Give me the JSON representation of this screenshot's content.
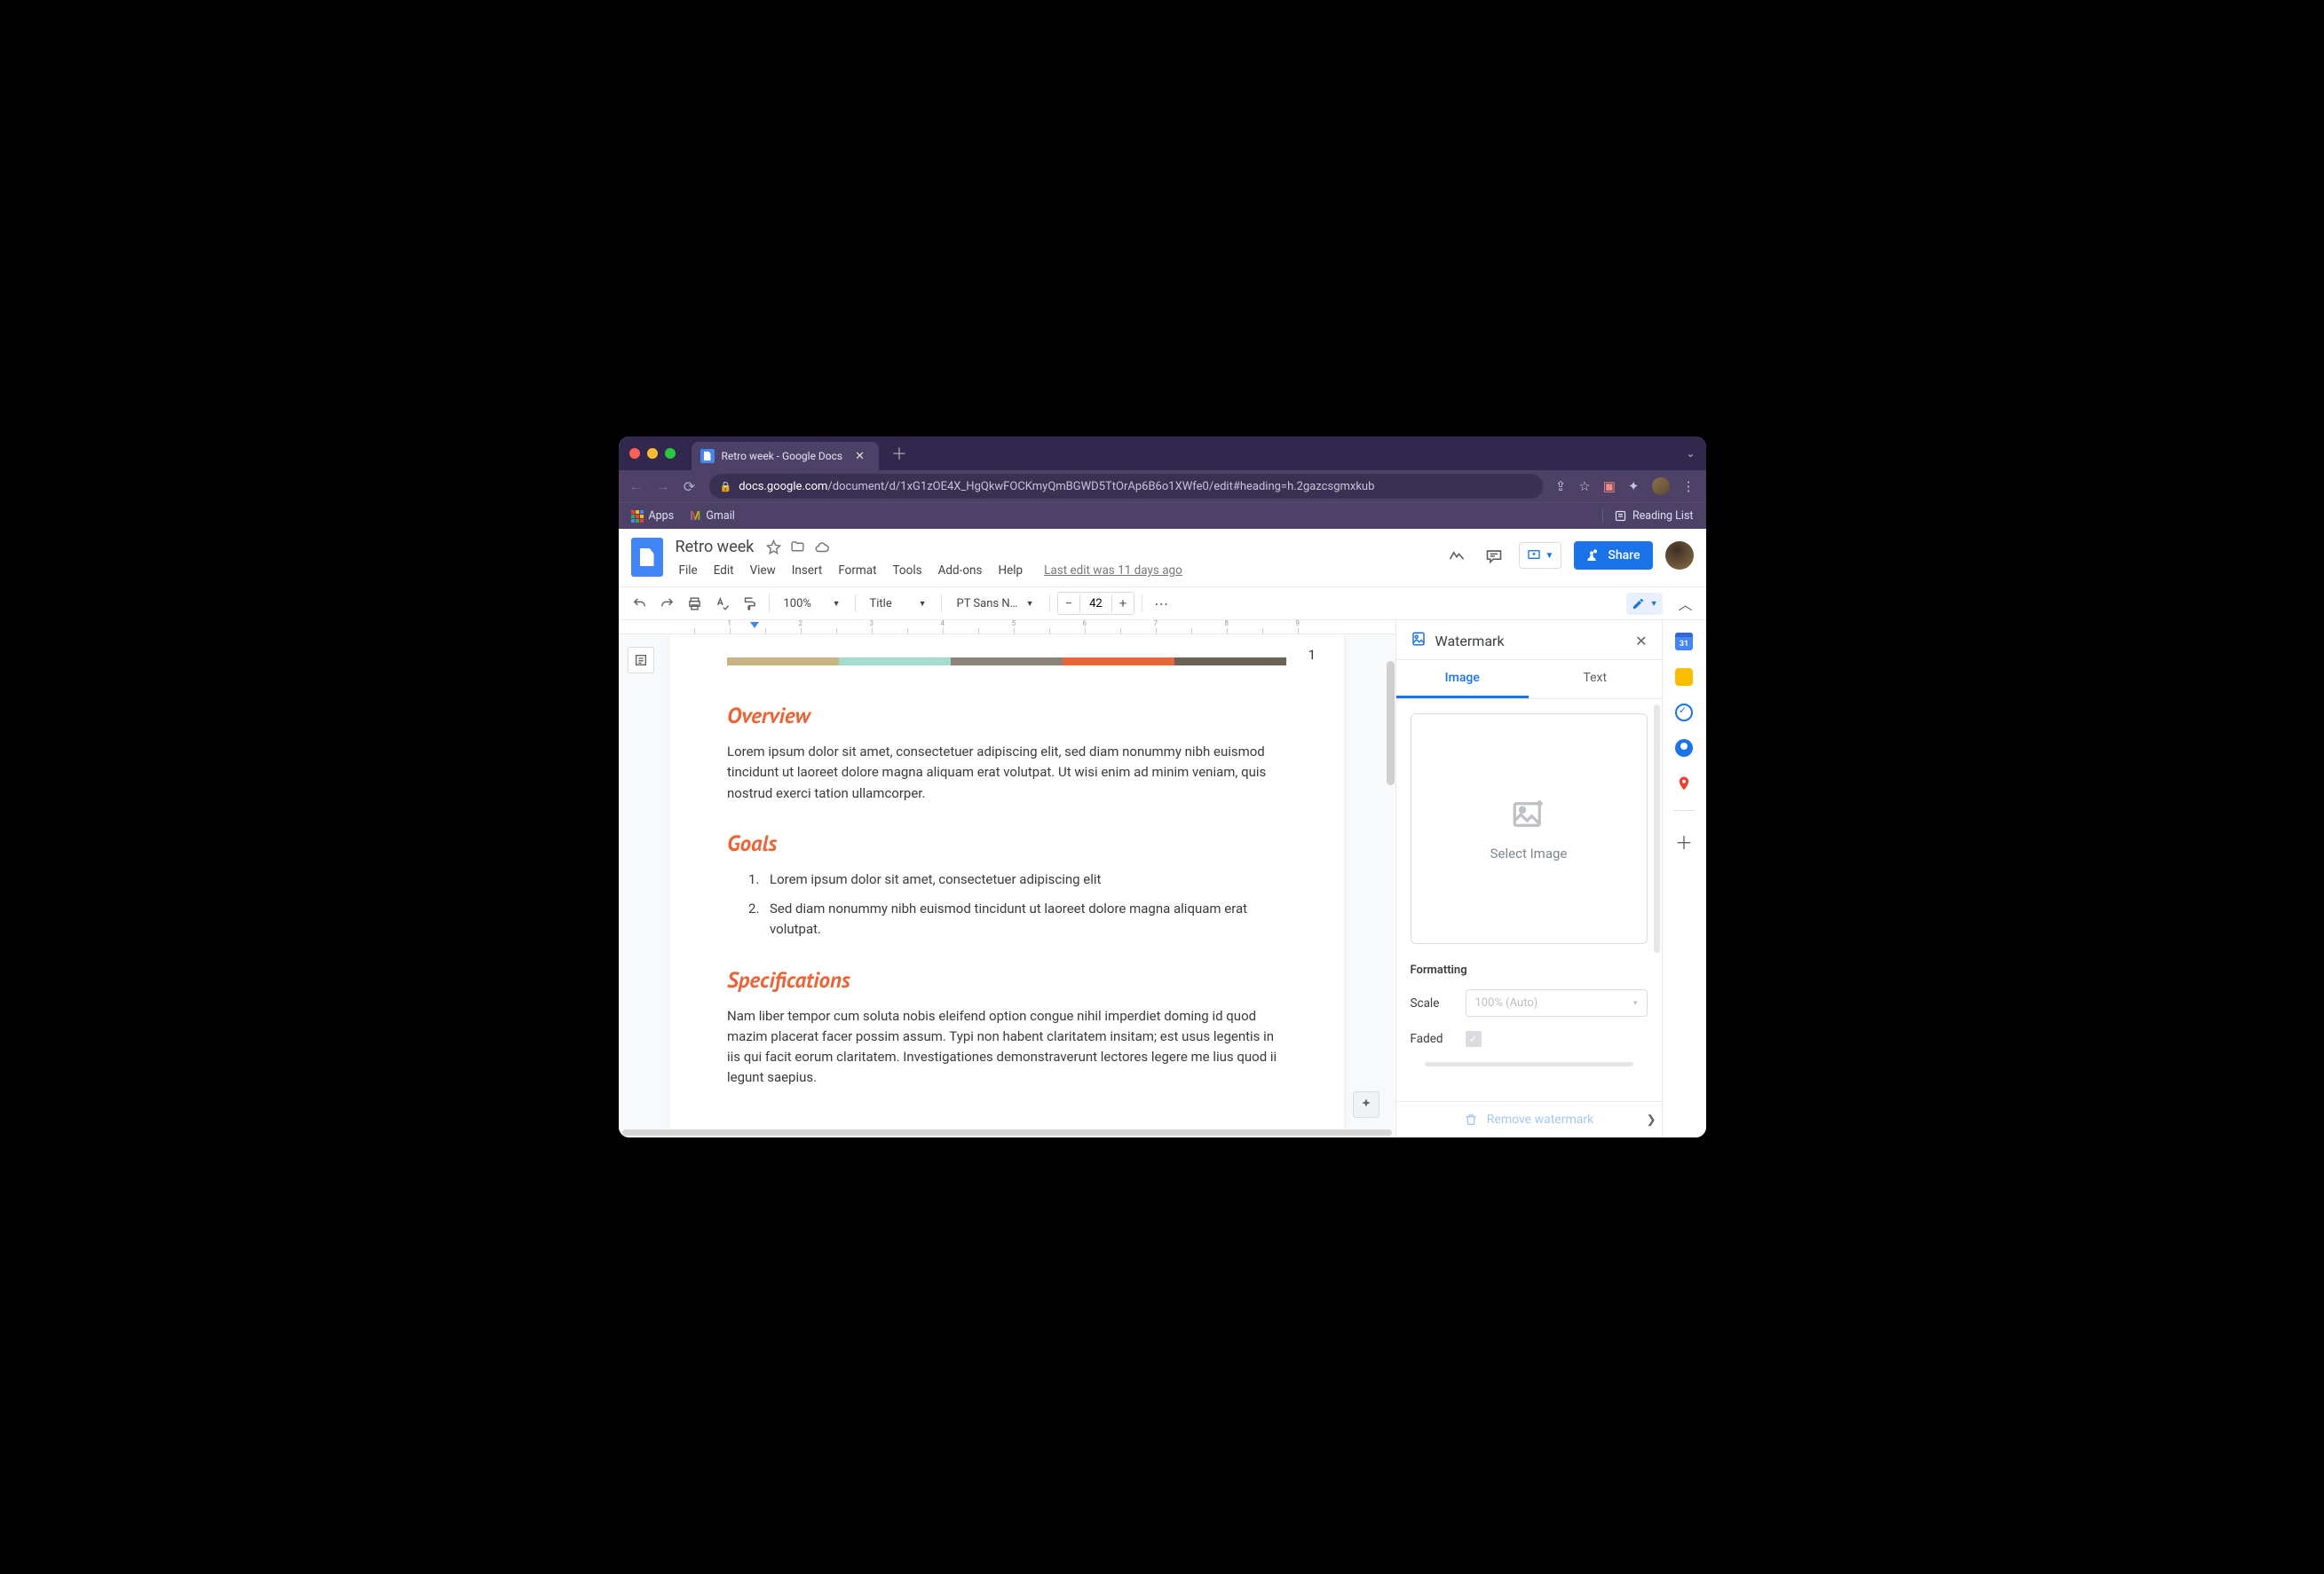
{
  "browser": {
    "tab_title": "Retro week - Google Docs",
    "url_host": "docs.google.com",
    "url_path": "/document/d/1xG1zOE4X_HgQkwFOCKmyQmBGWD5TtOrAp6B6o1XWfe0/edit#heading=h.2gazcsgmxkub",
    "bookmarks": {
      "apps": "Apps",
      "gmail": "Gmail",
      "reading_list": "Reading List"
    }
  },
  "doc": {
    "title": "Retro week",
    "menus": [
      "File",
      "Edit",
      "View",
      "Insert",
      "Format",
      "Tools",
      "Add-ons",
      "Help"
    ],
    "last_edit": "Last edit was 11 days ago",
    "share": "Share"
  },
  "toolbar": {
    "zoom": "100%",
    "style": "Title",
    "font": "PT Sans N…",
    "size": "42"
  },
  "page": {
    "number": "1",
    "sections": {
      "overview": {
        "title": "Overview",
        "body": "Lorem ipsum dolor sit amet, consectetuer adipiscing elit, sed diam nonummy nibh euismod tincidunt ut laoreet dolore magna aliquam erat volutpat. Ut wisi enim ad minim veniam, quis nostrud exerci tation ullamcorper."
      },
      "goals": {
        "title": "Goals",
        "items": [
          "Lorem ipsum dolor sit amet, consectetuer adipiscing elit",
          "Sed diam nonummy nibh euismod tincidunt ut laoreet dolore magna aliquam erat volutpat."
        ]
      },
      "specs": {
        "title": "Specifications",
        "body": "Nam liber tempor cum soluta nobis eleifend option congue nihil imperdiet doming id quod mazim placerat facer possim assum. Typi non habent claritatem insitam; est usus legentis in iis qui facit eorum claritatem. Investigationes demonstraverunt lectores legere me lius quod ii legunt saepius."
      }
    }
  },
  "panel": {
    "title": "Watermark",
    "tabs": {
      "image": "Image",
      "text": "Text"
    },
    "select_image": "Select Image",
    "formatting": "Formatting",
    "scale_label": "Scale",
    "scale_value": "100% (Auto)",
    "faded_label": "Faded",
    "remove": "Remove watermark"
  },
  "sidetray": {
    "calendar_day": "31"
  }
}
